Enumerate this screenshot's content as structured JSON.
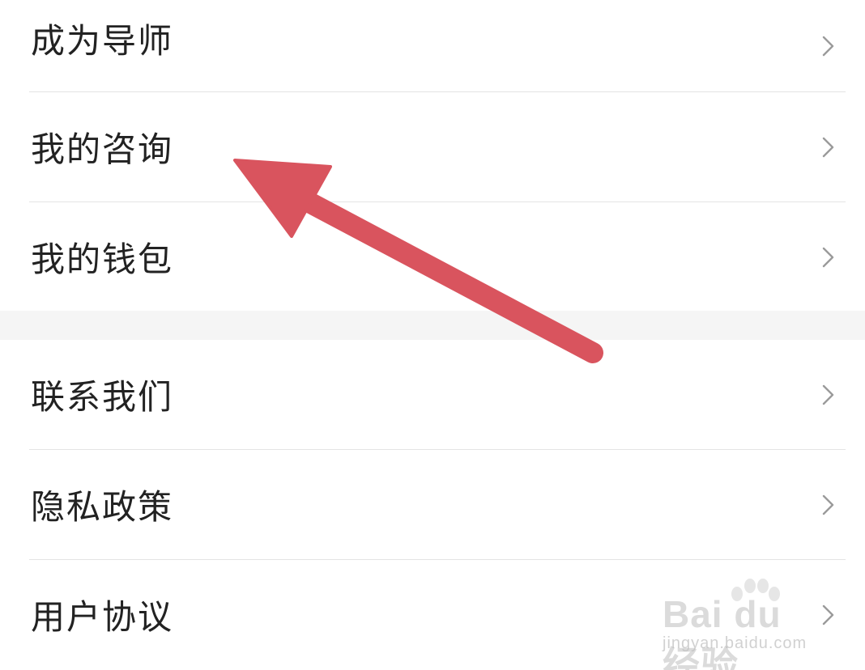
{
  "menu": {
    "group1": [
      {
        "label": "成为导师",
        "icon": "chevron-right-icon"
      },
      {
        "label": "我的咨询",
        "icon": "chevron-right-icon"
      },
      {
        "label": "我的钱包",
        "icon": "chevron-right-icon"
      }
    ],
    "group2": [
      {
        "label": "联系我们",
        "icon": "chevron-right-icon"
      },
      {
        "label": "隐私政策",
        "icon": "chevron-right-icon"
      },
      {
        "label": "用户协议",
        "icon": "chevron-right-icon"
      }
    ]
  },
  "annotation": {
    "type": "arrow",
    "color": "#d9545e",
    "points_to": "我的咨询"
  },
  "watermark": {
    "main": "Bai du 经验",
    "sub": "jingyan.baidu.com"
  },
  "colors": {
    "text": "#222222",
    "chevron": "#9a9a9a",
    "divider": "#e4e4e4",
    "group_gap": "#f5f5f5"
  }
}
